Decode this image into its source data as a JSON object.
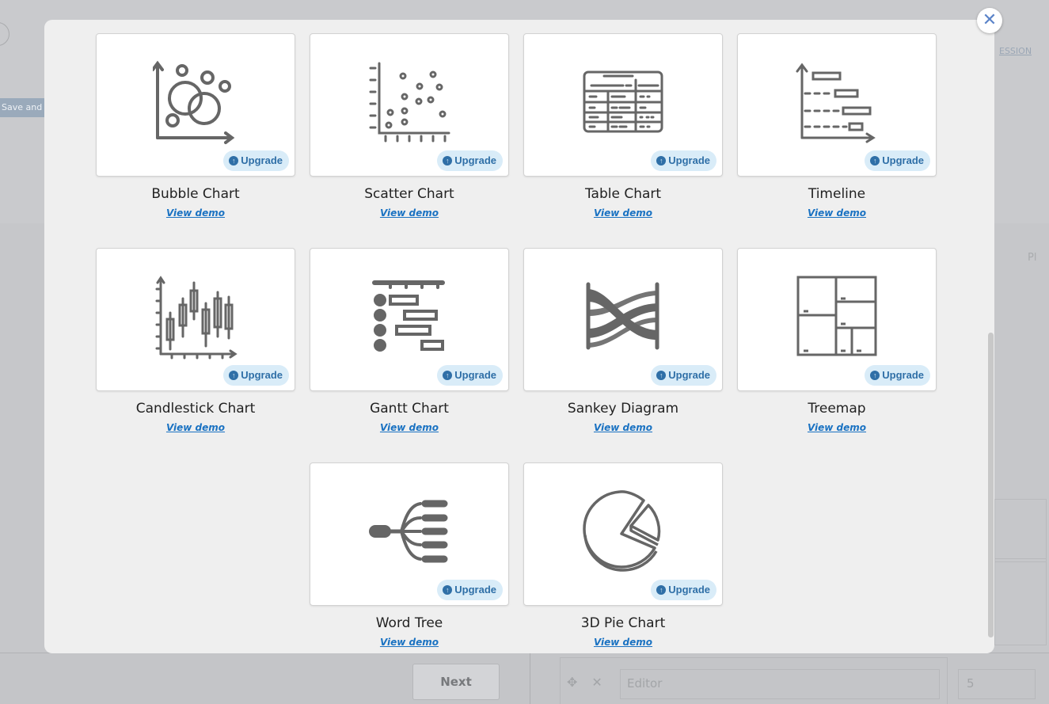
{
  "modal": {
    "close_label": "✕",
    "upgrade_label": "Upgrade",
    "demo_label": "View demo",
    "tiles": [
      {
        "title": "Bubble Chart",
        "icon": "bubble-chart-icon"
      },
      {
        "title": "Scatter Chart",
        "icon": "scatter-chart-icon"
      },
      {
        "title": "Table Chart",
        "icon": "table-chart-icon"
      },
      {
        "title": "Timeline",
        "icon": "timeline-icon"
      },
      {
        "title": "Candlestick Chart",
        "icon": "candlestick-chart-icon"
      },
      {
        "title": "Gantt Chart",
        "icon": "gantt-chart-icon"
      },
      {
        "title": "Sankey Diagram",
        "icon": "sankey-diagram-icon"
      },
      {
        "title": "Treemap",
        "icon": "treemap-icon"
      },
      {
        "title": "Word Tree",
        "icon": "word-tree-icon"
      },
      {
        "title": "3D Pie Chart",
        "icon": "pie-3d-icon"
      }
    ]
  },
  "background": {
    "chip_text": "Save and c",
    "next_label": "Next",
    "editor_placeholder": "Editor",
    "number_value": "5",
    "right_tab_text": "Pl",
    "right_link_text": "ESSION"
  },
  "colors": {
    "icon_gray": "#666666",
    "upgrade_bg": "#d9ecf8",
    "upgrade_text": "#2f6fa7",
    "link_blue": "#1a72c2",
    "close_blue": "#5a83c8"
  }
}
